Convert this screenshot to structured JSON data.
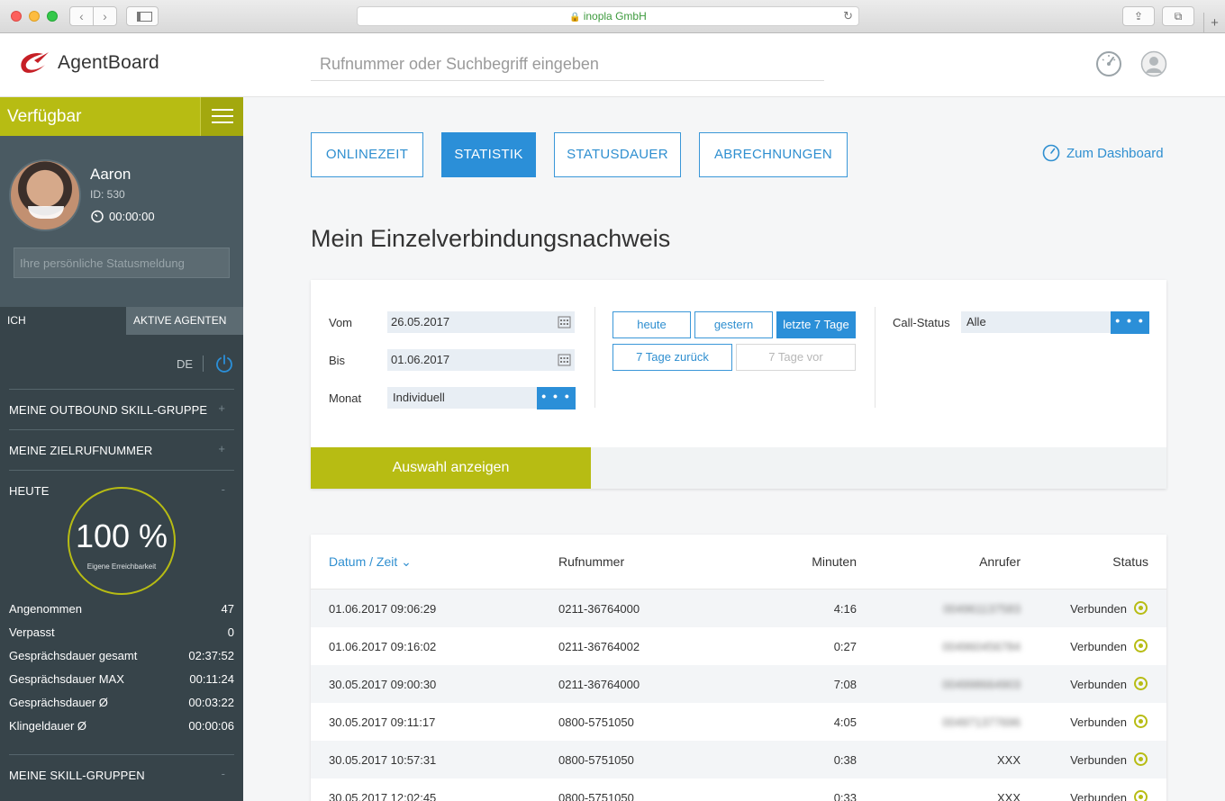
{
  "browser": {
    "url_text": "inopla GmbH"
  },
  "header": {
    "logo_text": "AgentBoard",
    "search_placeholder": "Rufnummer oder Suchbegriff eingeben"
  },
  "sidebar": {
    "availability": "Verfügbar",
    "profile": {
      "name": "Aaron",
      "id": "ID: 530",
      "timer": "00:00:00",
      "status_placeholder": "Ihre persönliche Statusmeldung"
    },
    "tabs": [
      "ICH",
      "AKTIVE AGENTEN"
    ],
    "language": "DE",
    "sections": {
      "outbound": "MEINE OUTBOUND SKILL-GRUPPE",
      "zielrufnummer": "MEINE ZIELRUFNUMMER",
      "heute": "HEUTE",
      "skill_gruppen": "MEINE SKILL-GRUPPEN"
    },
    "reachability": {
      "value": "100 %",
      "label": "Eigene Erreichbarkeit"
    },
    "stats": [
      {
        "label": "Angenommen",
        "value": "47"
      },
      {
        "label": "Verpasst",
        "value": "0"
      },
      {
        "label": "Gesprächsdauer gesamt",
        "value": "02:37:52"
      },
      {
        "label": "Gesprächsdauer MAX",
        "value": "00:11:24"
      },
      {
        "label": "Gesprächsdauer Ø",
        "value": "00:03:22"
      },
      {
        "label": "Klingeldauer Ø",
        "value": "00:00:06"
      }
    ]
  },
  "main": {
    "tabs": [
      "ONLINEZEIT",
      "STATISTIK",
      "STATUSDAUER",
      "ABRECHNUNGEN"
    ],
    "active_tab": "STATISTIK",
    "dashboard_link": "Zum Dashboard",
    "title": "Mein Einzelverbindungsnachweis",
    "filter": {
      "from_label": "Vom",
      "from_value": "26.05.2017",
      "to_label": "Bis",
      "to_value": "01.06.2017",
      "month_label": "Monat",
      "month_value": "Individuell",
      "quick": [
        "heute",
        "gestern",
        "letzte 7 Tage",
        "7 Tage zurück",
        "7 Tage vor"
      ],
      "call_status_label": "Call-Status",
      "call_status_value": "Alle",
      "dots": "• • •",
      "submit": "Auswahl anzeigen"
    },
    "table": {
      "headers": [
        "Datum / Zeit",
        "Rufnummer",
        "Minuten",
        "Anrufer",
        "Status"
      ],
      "sort_indicator": "⌄",
      "rows": [
        {
          "datetime": "01.06.2017 09:06:29",
          "number": "0211-36764000",
          "minutes": "4:16",
          "caller": "004961137583",
          "status": "Verbunden"
        },
        {
          "datetime": "01.06.2017 09:16:02",
          "number": "0211-36764002",
          "minutes": "0:27",
          "caller": "004960456784",
          "status": "Verbunden"
        },
        {
          "datetime": "30.05.2017 09:00:30",
          "number": "0211-36764000",
          "minutes": "7:08",
          "caller": "004998664903",
          "status": "Verbunden"
        },
        {
          "datetime": "30.05.2017 09:11:17",
          "number": "0800-5751050",
          "minutes": "4:05",
          "caller": "004971377696",
          "status": "Verbunden"
        },
        {
          "datetime": "30.05.2017 10:57:31",
          "number": "0800-5751050",
          "minutes": "0:38",
          "caller": "XXX",
          "status": "Verbunden"
        },
        {
          "datetime": "30.05.2017 12:02:45",
          "number": "0800-5751050",
          "minutes": "0:33",
          "caller": "XXX",
          "status": "Verbunden"
        }
      ]
    }
  },
  "colors": {
    "accent_blue": "#2b8fd8",
    "accent_green": "#b7bc13",
    "sidebar_bg": "#37444a"
  }
}
